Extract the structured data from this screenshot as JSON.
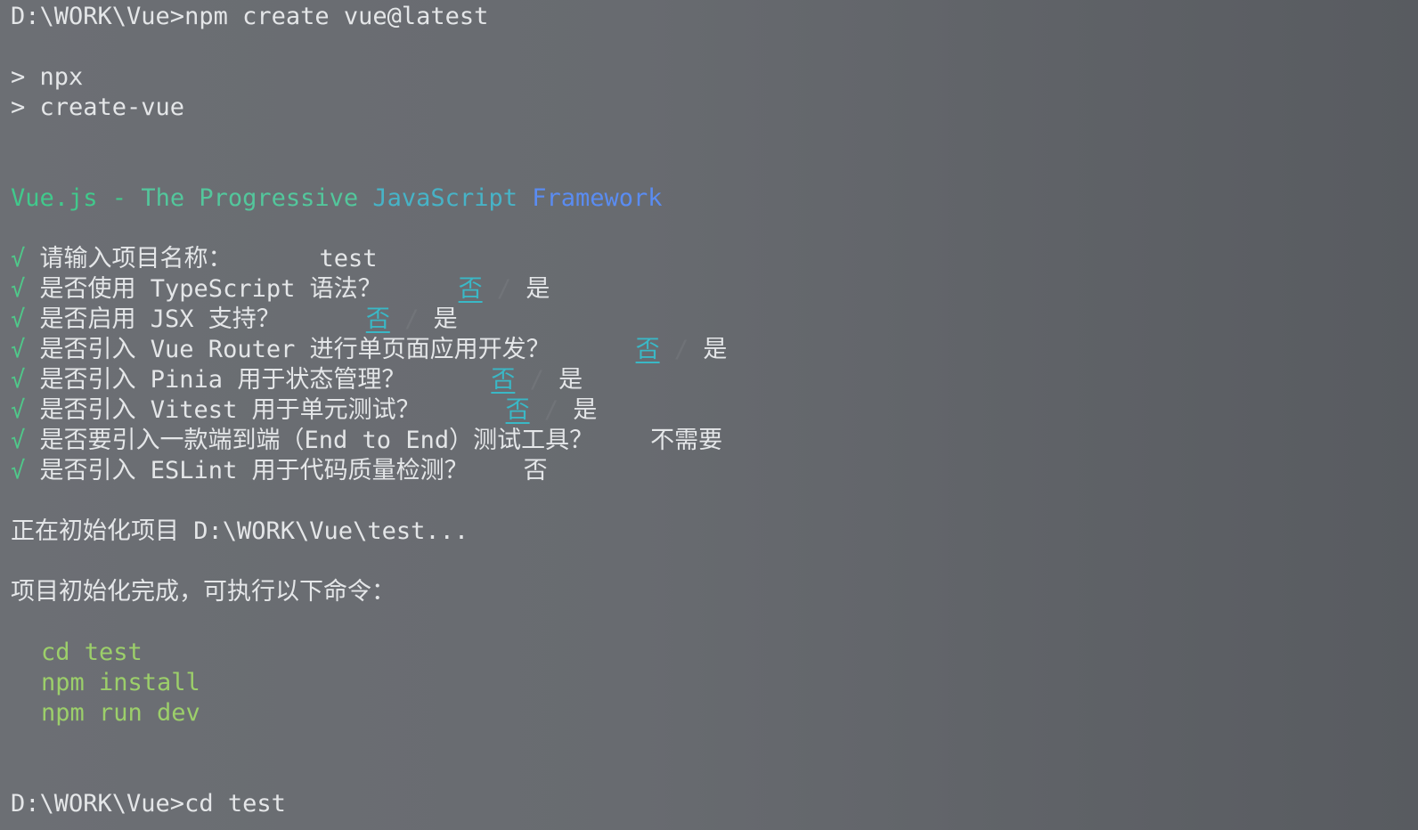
{
  "terminal": {
    "prompt_command": "D:\\WORK\\Vue>npm create vue@latest",
    "npx_lines": [
      "> npx",
      "> create-vue"
    ],
    "banner": {
      "part1": "Vue.js - ",
      "part2": "The Progressive ",
      "part3": "JavaScript ",
      "part4": "Framework"
    },
    "check_mark": "√",
    "questions": [
      {
        "label": "请输入项目名称：",
        "answer": "test"
      },
      {
        "label": "是否使用 TypeScript 语法？",
        "selected": "否",
        "other": "是",
        "sep": "/"
      },
      {
        "label": "是否启用 JSX 支持？",
        "selected": "否",
        "other": "是",
        "sep": "/"
      },
      {
        "label": "是否引入 Vue Router 进行单页面应用开发？",
        "selected": "否",
        "other": "是",
        "sep": "/"
      },
      {
        "label": "是否引入 Pinia 用于状态管理？",
        "selected": "否",
        "other": "是",
        "sep": "/"
      },
      {
        "label": "是否引入 Vitest 用于单元测试？",
        "selected": "否",
        "other": "是",
        "sep": "/"
      },
      {
        "label": "是否要引入一款端到端（End to End）测试工具？",
        "answer": "不需要"
      },
      {
        "label": "是否引入 ESLint 用于代码质量检测？",
        "answer": "否"
      }
    ],
    "initializing": "正在初始化项目 D:\\WORK\\Vue\\test...",
    "done_message": "项目初始化完成，可执行以下命令：",
    "commands": [
      "cd test",
      "npm install",
      "npm run dev"
    ],
    "final_prompt": "D:\\WORK\\Vue>cd test"
  },
  "colors": {
    "check": "#4fc98a",
    "selected_option": "#3ab8c6",
    "commands": "#9ccf6a",
    "banner_start": "#41c98c",
    "banner_end": "#5a8cf2"
  }
}
